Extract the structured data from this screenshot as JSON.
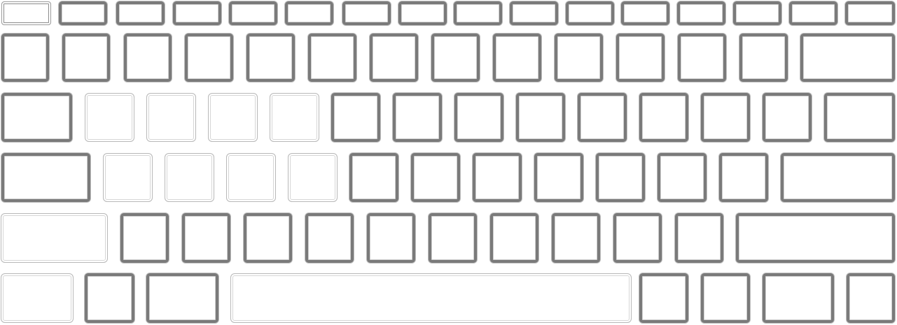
{
  "keyboard": {
    "rows": [
      {
        "name": "function-row",
        "keys": [
          {
            "id": "esc",
            "label": "",
            "style": "esc-style"
          },
          {
            "id": "f1",
            "label": "",
            "style": "bold"
          },
          {
            "id": "f2",
            "label": "",
            "style": "bold"
          },
          {
            "id": "f3",
            "label": "",
            "style": "bold"
          },
          {
            "id": "f4",
            "label": "",
            "style": "bold"
          },
          {
            "id": "f5",
            "label": "",
            "style": "bold"
          },
          {
            "id": "f6",
            "label": "",
            "style": "bold"
          },
          {
            "id": "f7",
            "label": "",
            "style": "bold"
          },
          {
            "id": "f8",
            "label": "",
            "style": "bold"
          },
          {
            "id": "f9",
            "label": "",
            "style": "bold"
          },
          {
            "id": "f10",
            "label": "",
            "style": "bold"
          },
          {
            "id": "f11",
            "label": "",
            "style": "bold"
          },
          {
            "id": "f12",
            "label": "",
            "style": "bold"
          },
          {
            "id": "f13",
            "label": "",
            "style": "bold"
          },
          {
            "id": "f14",
            "label": "",
            "style": "bold"
          },
          {
            "id": "power",
            "label": "",
            "style": "bold"
          }
        ]
      },
      {
        "name": "number-row",
        "keys": [
          {
            "id": "backtick",
            "label": "",
            "style": "bold"
          },
          {
            "id": "1",
            "label": "",
            "style": "bold"
          },
          {
            "id": "2",
            "label": "",
            "style": "bold"
          },
          {
            "id": "3",
            "label": "",
            "style": "bold"
          },
          {
            "id": "4",
            "label": "",
            "style": "bold"
          },
          {
            "id": "5",
            "label": "",
            "style": "bold"
          },
          {
            "id": "6",
            "label": "",
            "style": "bold"
          },
          {
            "id": "7",
            "label": "",
            "style": "bold"
          },
          {
            "id": "8",
            "label": "",
            "style": "bold"
          },
          {
            "id": "9",
            "label": "",
            "style": "bold"
          },
          {
            "id": "0",
            "label": "",
            "style": "bold"
          },
          {
            "id": "minus",
            "label": "",
            "style": "bold"
          },
          {
            "id": "equals",
            "label": "",
            "style": "bold"
          },
          {
            "id": "backspace",
            "label": "",
            "style": "bold"
          }
        ]
      },
      {
        "name": "qwerty-row",
        "keys": [
          {
            "id": "tab",
            "label": "",
            "style": "bold"
          },
          {
            "id": "q",
            "label": "",
            "style": "faint"
          },
          {
            "id": "w",
            "label": "",
            "style": "faint"
          },
          {
            "id": "e",
            "label": "",
            "style": "faint"
          },
          {
            "id": "r",
            "label": "",
            "style": "faint"
          },
          {
            "id": "t",
            "label": "",
            "style": "bold"
          },
          {
            "id": "y",
            "label": "",
            "style": "bold"
          },
          {
            "id": "u",
            "label": "",
            "style": "bold"
          },
          {
            "id": "i",
            "label": "",
            "style": "bold"
          },
          {
            "id": "o",
            "label": "",
            "style": "bold"
          },
          {
            "id": "p",
            "label": "",
            "style": "bold"
          },
          {
            "id": "lbracket",
            "label": "",
            "style": "bold"
          },
          {
            "id": "rbracket",
            "label": "",
            "style": "bold"
          },
          {
            "id": "backslash",
            "label": "",
            "style": "bold"
          }
        ]
      },
      {
        "name": "home-row",
        "keys": [
          {
            "id": "caps",
            "label": "",
            "style": "bold"
          },
          {
            "id": "a",
            "label": "",
            "style": "faint"
          },
          {
            "id": "s",
            "label": "",
            "style": "faint"
          },
          {
            "id": "d",
            "label": "",
            "style": "faint"
          },
          {
            "id": "f",
            "label": "",
            "style": "faint"
          },
          {
            "id": "g",
            "label": "",
            "style": "bold"
          },
          {
            "id": "h",
            "label": "",
            "style": "bold"
          },
          {
            "id": "j",
            "label": "",
            "style": "bold"
          },
          {
            "id": "k",
            "label": "",
            "style": "bold"
          },
          {
            "id": "l",
            "label": "",
            "style": "bold"
          },
          {
            "id": "semicolon",
            "label": "",
            "style": "bold"
          },
          {
            "id": "quote",
            "label": "",
            "style": "bold"
          },
          {
            "id": "enter",
            "label": "",
            "style": "bold"
          }
        ]
      },
      {
        "name": "bottom-letter-row",
        "keys": [
          {
            "id": "lshift",
            "label": "",
            "style": "faint"
          },
          {
            "id": "z",
            "label": "",
            "style": "bold"
          },
          {
            "id": "x",
            "label": "",
            "style": "bold"
          },
          {
            "id": "c",
            "label": "",
            "style": "bold"
          },
          {
            "id": "v",
            "label": "",
            "style": "bold"
          },
          {
            "id": "b",
            "label": "",
            "style": "bold"
          },
          {
            "id": "n",
            "label": "",
            "style": "bold"
          },
          {
            "id": "m",
            "label": "",
            "style": "bold"
          },
          {
            "id": "comma",
            "label": "",
            "style": "bold"
          },
          {
            "id": "period",
            "label": "",
            "style": "bold"
          },
          {
            "id": "slash",
            "label": "",
            "style": "bold"
          },
          {
            "id": "rshift",
            "label": "",
            "style": "bold"
          }
        ]
      },
      {
        "name": "modifier-row",
        "keys": [
          {
            "id": "lctrl",
            "label": "",
            "style": "faint"
          },
          {
            "id": "lalt",
            "label": "",
            "style": "bold"
          },
          {
            "id": "lcmd",
            "label": "",
            "style": "bold"
          },
          {
            "id": "space",
            "label": "",
            "style": "faint"
          },
          {
            "id": "rcmd",
            "label": "",
            "style": "bold"
          },
          {
            "id": "ralt",
            "label": "",
            "style": "bold"
          },
          {
            "id": "fn",
            "label": "",
            "style": "bold"
          },
          {
            "id": "rctrl",
            "label": "",
            "style": "bold"
          }
        ]
      }
    ]
  }
}
